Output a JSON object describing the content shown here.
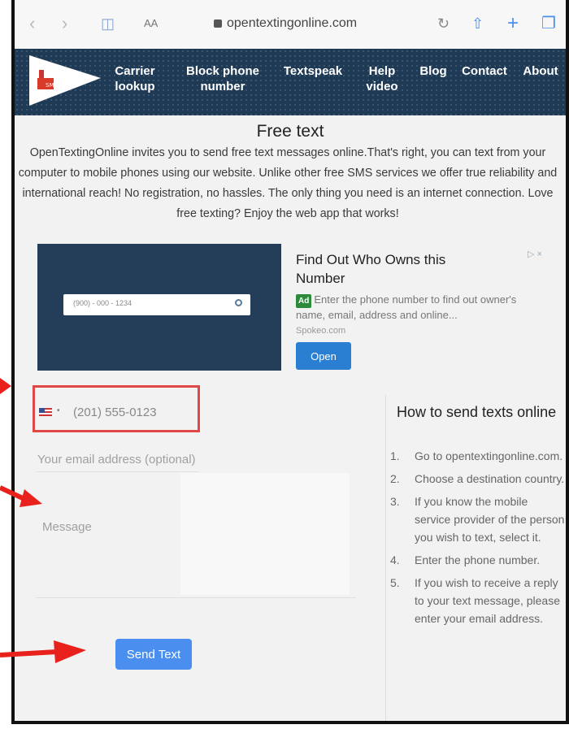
{
  "browser": {
    "url": "opentextingonline.com",
    "text_size_label": "AA"
  },
  "nav": [
    {
      "label": "Carrier lookup"
    },
    {
      "label": "Block phone number"
    },
    {
      "label": "Textspeak"
    },
    {
      "label": "Help video"
    },
    {
      "label": "Blog"
    },
    {
      "label": "Contact"
    },
    {
      "label": "About"
    }
  ],
  "page": {
    "title": "Free text",
    "intro": "OpenTextingOnline invites you to send free text messages online.That's right, you can text from your computer to mobile phones using our website. Unlike other free SMS services we offer true reliability and international reach! No registration, no hassles. The only thing you need is an internet connection. Love free texting? Enjoy the web app that works!"
  },
  "ad": {
    "search_placeholder": "(900) - 000 - 1234",
    "headline": "Find Out Who Owns this Number",
    "badge": "Ad",
    "body": "Enter the phone number to find out owner's name, email, address and online...",
    "domain": "Spokeo.com",
    "cta": "Open",
    "adchoices": "▷ ×"
  },
  "form": {
    "phone_placeholder": "(201) 555-0123",
    "email_placeholder": "Your email address (optional)",
    "message_placeholder": "Message",
    "send_label": "Send Text",
    "country_flag": "us-flag-icon"
  },
  "how_to": {
    "title": "How to send texts online",
    "steps": [
      {
        "num": "1.",
        "text": "Go to opentextingonline.com."
      },
      {
        "num": "2.",
        "text": "Choose a destination country."
      },
      {
        "num": "3.",
        "text": "If you know the mobile service provider of the person you wish to text, select it."
      },
      {
        "num": "4.",
        "text": "Enter the phone number."
      },
      {
        "num": "5.",
        "text": "If you wish to receive a reply to your text message, please enter your email address."
      }
    ]
  },
  "colors": {
    "header_bg": "#1e3a55",
    "highlight": "#e04848",
    "send_button": "#4a8ff0",
    "ad_button": "#2a7fd3"
  }
}
